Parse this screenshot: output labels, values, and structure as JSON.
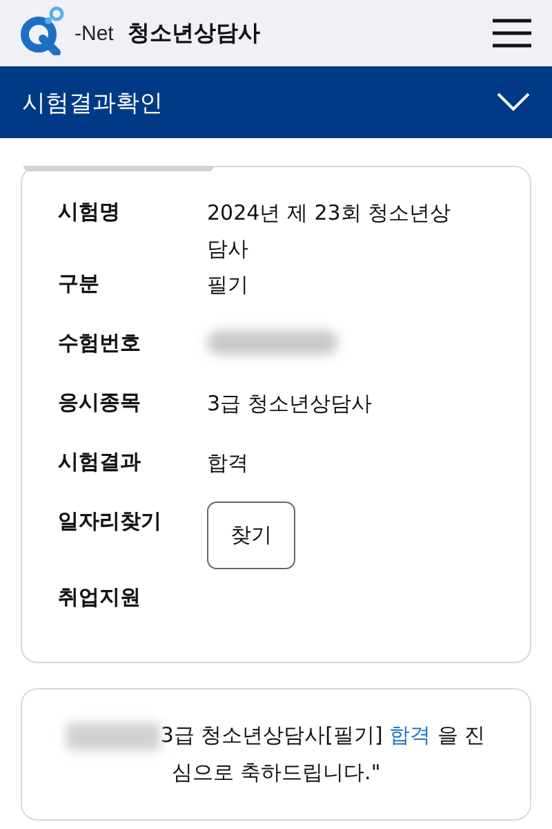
{
  "header": {
    "logo_text": "-Net",
    "site_title": "청소년상담사"
  },
  "section_bar": {
    "title": "시험결과확인",
    "expanded": false
  },
  "result_card": {
    "rows": [
      {
        "kind": "text",
        "label": "시험명",
        "value": "2024년 제 23회 청소년상담사"
      },
      {
        "kind": "text",
        "label": "구분",
        "value": "필기"
      },
      {
        "kind": "redacted",
        "label": "수험번호"
      },
      {
        "kind": "text",
        "label": "응시종목",
        "value": "3급 청소년상담사"
      },
      {
        "kind": "text",
        "label": "시험결과",
        "value": "합격"
      },
      {
        "kind": "button",
        "label": "일자리찾기",
        "button": "찾기"
      },
      {
        "kind": "empty",
        "label": "취업지원"
      }
    ]
  },
  "message_card": {
    "before": "3급 청소년상담사[필기]",
    "highlight": "합격",
    "after": "을 진심으로 축하드립니다.\""
  }
}
